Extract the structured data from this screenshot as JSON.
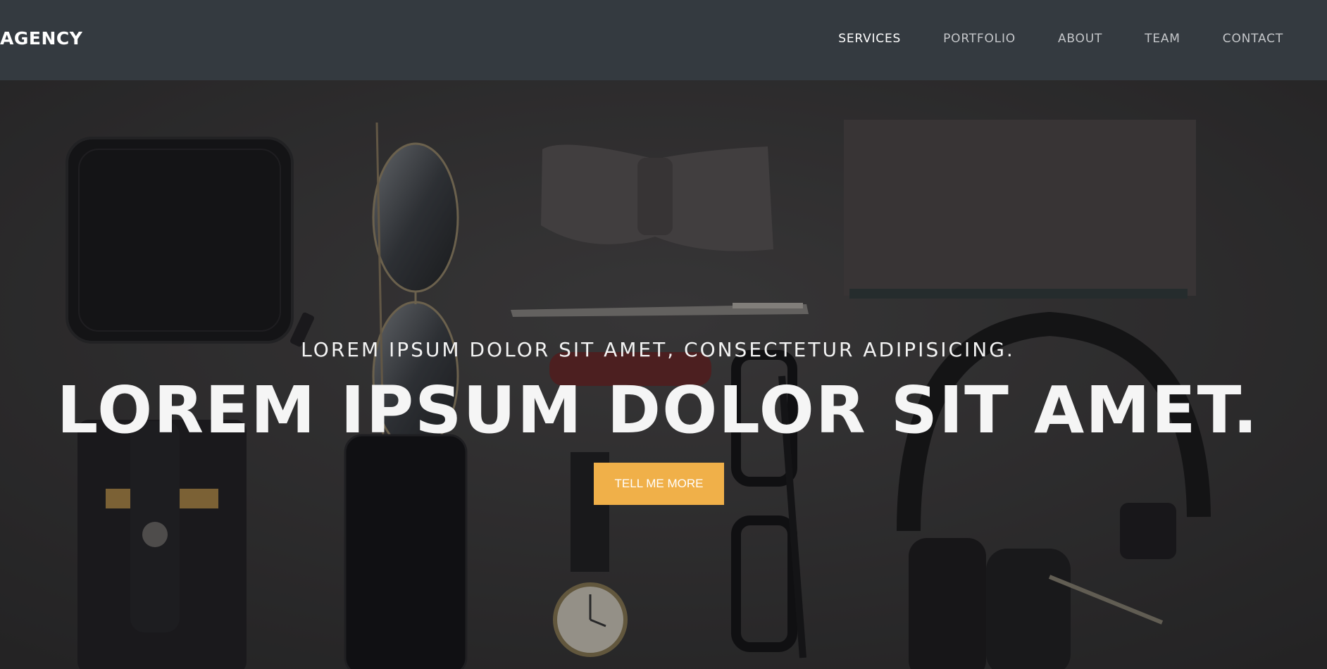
{
  "navbar": {
    "brand": "AGENCY",
    "links": [
      {
        "label": "SERVICES"
      },
      {
        "label": "PORTFOLIO"
      },
      {
        "label": "ABOUT"
      },
      {
        "label": "TEAM"
      },
      {
        "label": "CONTACT"
      }
    ]
  },
  "hero": {
    "subheading": "LOREM IPSUM DOLOR SIT AMET, CONSECTETUR ADIPISICING.",
    "heading": "LOREM IPSUM DOLOR SIT AMET.",
    "cta_label": "TELL ME MORE"
  },
  "colors": {
    "navbar_bg": "#343a40",
    "accent": "#f0b049"
  }
}
